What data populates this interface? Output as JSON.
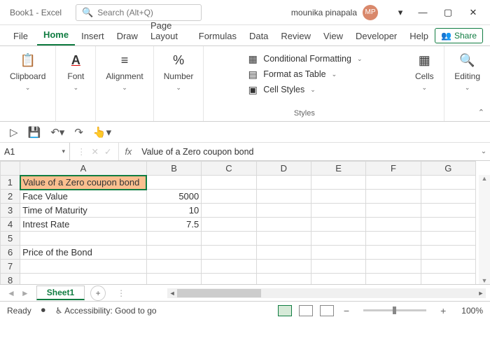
{
  "titlebar": {
    "title": "Book1  -  Excel",
    "search_placeholder": "Search (Alt+Q)",
    "username": "mounika pinapala",
    "avatar_initials": "MP"
  },
  "tabs": {
    "file": "File",
    "home": "Home",
    "insert": "Insert",
    "draw": "Draw",
    "page_layout": "Page Layout",
    "formulas": "Formulas",
    "data": "Data",
    "review": "Review",
    "view": "View",
    "developer": "Developer",
    "help": "Help",
    "share": "Share"
  },
  "ribbon": {
    "clipboard": "Clipboard",
    "font": "Font",
    "alignment": "Alignment",
    "number": "Number",
    "cond_fmt": "Conditional Formatting",
    "fmt_table": "Format as Table",
    "cell_styles": "Cell Styles",
    "styles": "Styles",
    "cells": "Cells",
    "editing": "Editing"
  },
  "namebox": {
    "ref": "A1"
  },
  "formula_bar": {
    "value": "Value of a Zero coupon bond"
  },
  "columns": [
    "A",
    "B",
    "C",
    "D",
    "E",
    "F",
    "G"
  ],
  "rows": [
    {
      "n": "1",
      "A": "Value of a Zero coupon bond",
      "B": "",
      "sel": true
    },
    {
      "n": "2",
      "A": "Face Value",
      "B": "5000"
    },
    {
      "n": "3",
      "A": "Time of Maturity",
      "B": "10"
    },
    {
      "n": "4",
      "A": "Intrest Rate",
      "B": "7.5"
    },
    {
      "n": "5",
      "A": "",
      "B": ""
    },
    {
      "n": "6",
      "A": "Price of the Bond",
      "B": ""
    },
    {
      "n": "7",
      "A": "",
      "B": ""
    },
    {
      "n": "8",
      "A": "",
      "B": ""
    }
  ],
  "sheets": {
    "active": "Sheet1"
  },
  "status": {
    "ready": "Ready",
    "accessibility": "Accessibility: Good to go",
    "zoom": "100%"
  }
}
